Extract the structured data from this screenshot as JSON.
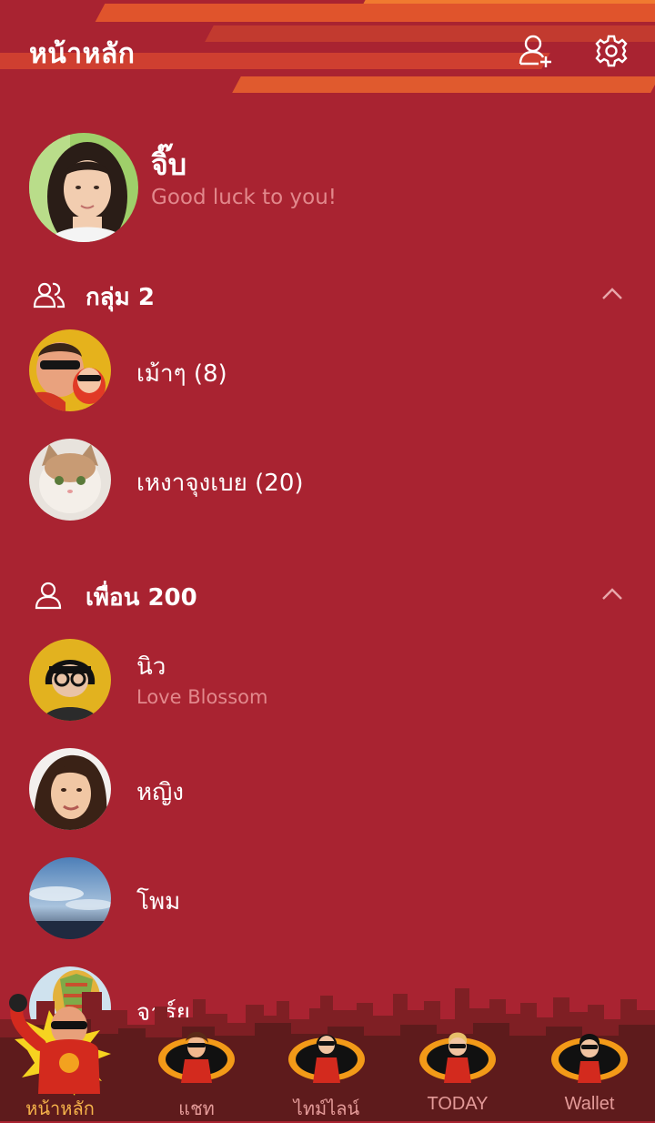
{
  "header": {
    "title": "หน้าหลัก",
    "add_friend_icon": "add-friend-icon",
    "settings_icon": "gear-icon"
  },
  "profile": {
    "name": "จิ๊บ",
    "status": "Good luck to you!"
  },
  "groups": {
    "label": "กลุ่ม 2",
    "items": [
      {
        "name": "เม้าๆ (8)"
      },
      {
        "name": "เหงาจุงเบย (20)"
      }
    ]
  },
  "friends": {
    "label": "เพื่อน 200",
    "items": [
      {
        "name": "นิว",
        "status": "Love Blossom"
      },
      {
        "name": "หญิง"
      },
      {
        "name": "โพม"
      },
      {
        "name": "จาร์ย"
      }
    ]
  },
  "nav": {
    "items": [
      {
        "label": "หน้าหลัก",
        "active": true
      },
      {
        "label": "แชท"
      },
      {
        "label": "ไทม์ไลน์"
      },
      {
        "label": "TODAY"
      },
      {
        "label": "Wallet"
      }
    ]
  },
  "colors": {
    "background": "#a92331",
    "accent": "#f5b24a",
    "status_text": "#e2888c",
    "stripe": "#e0542c"
  }
}
